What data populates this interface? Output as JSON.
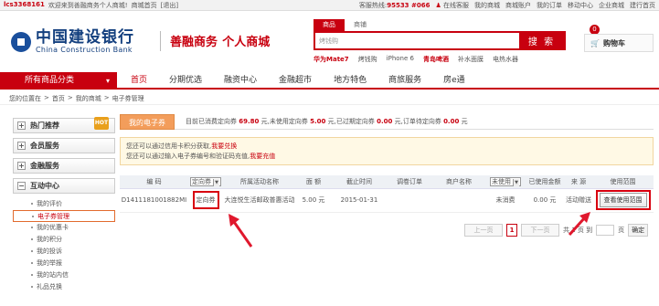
{
  "topbar": {
    "user": "lcs3368161",
    "welcome": "欢迎来到善融商务个人商城!",
    "home": "商城首页",
    "logout": "[退出]",
    "hotline_label": "客服热线:",
    "hotline_number": "95533 #066",
    "online_service": "在线客服",
    "my_mall": "我的商城",
    "mall_account": "商城账户",
    "my_orders": "我的订单",
    "mobile": "移动中心",
    "enterprise": "企业商城",
    "build_mall": "建行首页"
  },
  "header": {
    "logo_cn": "中国建设银行",
    "logo_en": "China Construction Bank",
    "brand": "善融商务",
    "brand_sub": "个人商城",
    "search_tabs": [
      "商品",
      "商铺"
    ],
    "search_placeholder": "搜索",
    "search_value": "烤钱购",
    "search_button": "搜 索",
    "hotwords": [
      "华为Mate7",
      "烤钱购",
      "iPhone 6",
      "青岛啤酒",
      "补水面膜",
      "电热水器"
    ],
    "cart_label": "购物车",
    "cart_count": "0"
  },
  "nav": {
    "categories": "所有商品分类",
    "items": [
      "首页",
      "分期优选",
      "融资中心",
      "金融超市",
      "地方特色",
      "商旅服务",
      "房e通"
    ]
  },
  "breadcrumb": [
    "您的位置在",
    ">",
    "首页",
    ">",
    "我的商城",
    ">",
    "电子券管理"
  ],
  "sidebar": {
    "sections": [
      "热门推荐",
      "会员服务",
      "金融服务",
      "互动中心"
    ],
    "hot_badge": "HOT",
    "items": [
      "我的评价",
      "电子券管理",
      "我的优惠卡",
      "我的积分",
      "我的投诉",
      "我的举报",
      "我的站内信",
      "礼品兑换"
    ]
  },
  "main": {
    "tab": "我的电子券",
    "summary_1": "目前已消费定向券",
    "spent": "69.80",
    "summary_2": "元,未使用定向券",
    "unused": "5.00",
    "summary_3": "元,已过期定向券",
    "expired": "0.00",
    "summary_4": "元,订单待定向券",
    "pending": "0.00",
    "unit": "元",
    "notice_1": "您还可以通过信用卡积分获取,",
    "notice_1_link": "我要兑换",
    "notice_2": "您还可以通过输入电子券编号和验证码充值,",
    "notice_2_link": "我要充值"
  },
  "table": {
    "headers": [
      "编 码",
      "定向券",
      "所属活动名称",
      "面 额",
      "截止时间",
      "调卷订单",
      "商户名称",
      "未使用",
      "已使用金额",
      "来 源",
      "使用范围"
    ],
    "row": {
      "code": "D1411181001882MI",
      "type": "定向券",
      "activity": "大连悦生活邮政普惠活动",
      "amount": "5.00 元",
      "deadline": "2015-01-31",
      "order": "",
      "merchant": "",
      "status": "未消费",
      "used": "0.00 元",
      "source": "活动赠送",
      "scope_button": "查看使用范围"
    }
  },
  "pager": {
    "prev": "上一页",
    "page": "1",
    "next": "下一页",
    "total_pre": "共 1 页 到",
    "total_post": "页",
    "go": "确定"
  }
}
